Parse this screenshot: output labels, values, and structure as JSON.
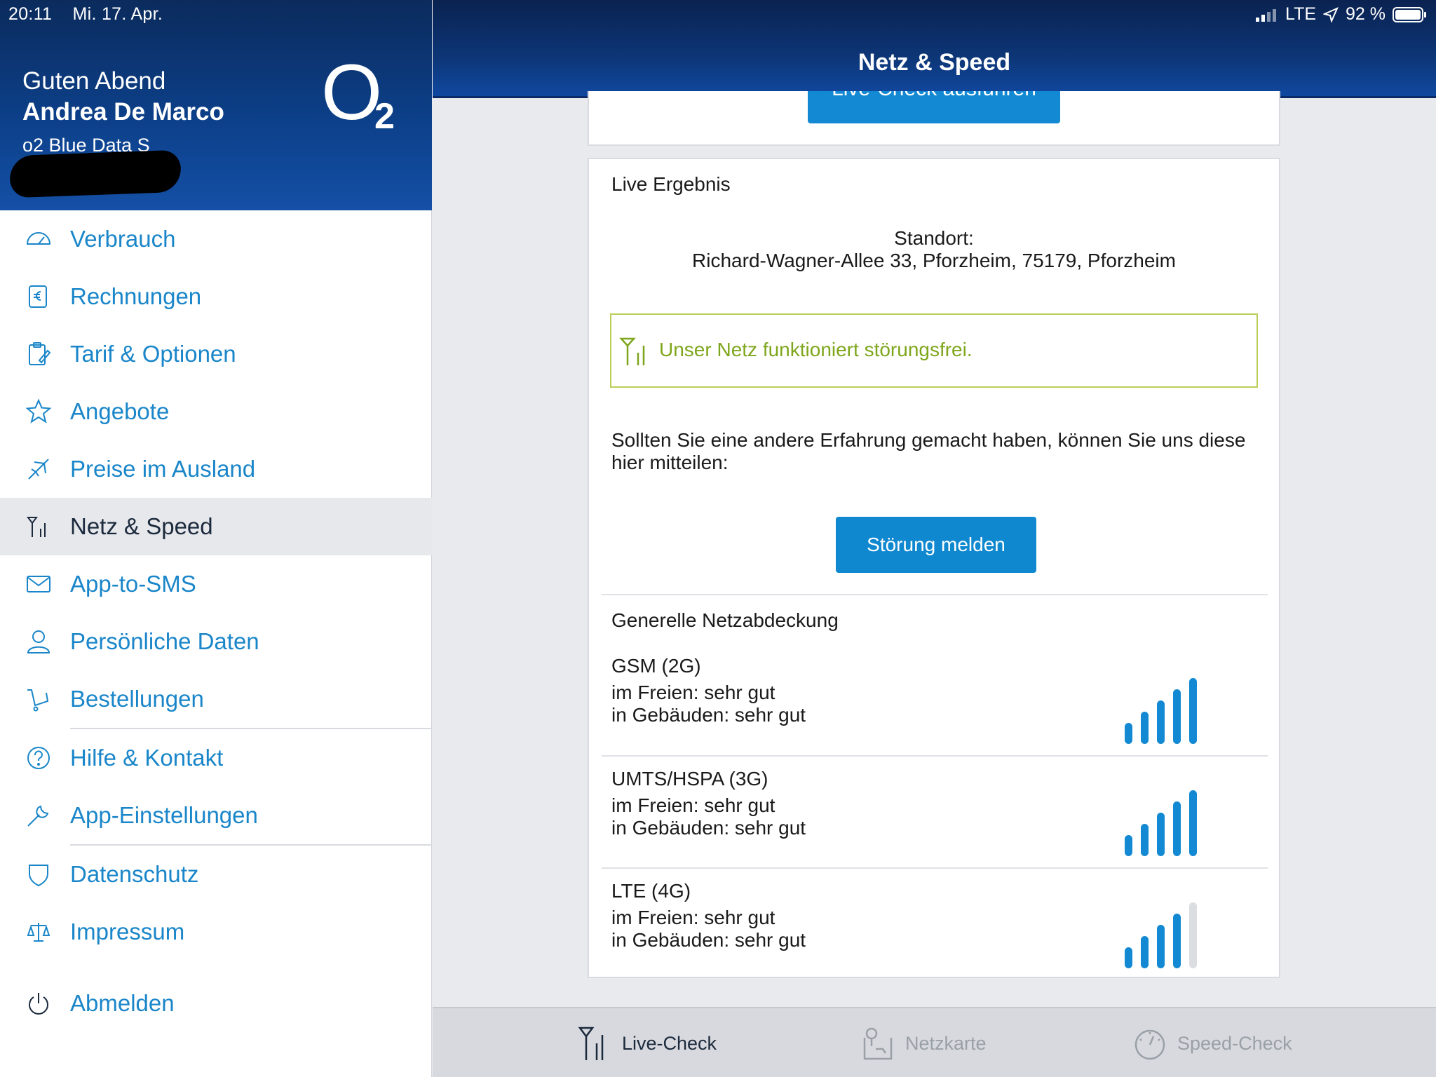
{
  "status": {
    "time": "20:11",
    "date": "Mi. 17. Apr.",
    "network": "LTE",
    "battery": "92 %"
  },
  "profile": {
    "greeting": "Guten Abend",
    "name": "Andrea De Marco",
    "tariff": "o2 Blue Data S",
    "logo_o": "O",
    "logo_2": "2"
  },
  "nav": {
    "items": [
      {
        "label": "Verbrauch",
        "icon": "speedometer-icon"
      },
      {
        "label": "Rechnungen",
        "icon": "invoice-euro-icon"
      },
      {
        "label": "Tarif & Optionen",
        "icon": "clipboard-edit-icon"
      },
      {
        "label": "Angebote",
        "icon": "star-icon"
      },
      {
        "label": "Preise im Ausland",
        "icon": "airplane-icon"
      },
      {
        "label": "Netz & Speed",
        "icon": "antenna-icon",
        "active": true
      },
      {
        "label": "App-to-SMS",
        "icon": "envelope-icon"
      },
      {
        "label": "Persönliche Daten",
        "icon": "person-icon"
      },
      {
        "label": "Bestellungen",
        "icon": "cart-icon"
      },
      {
        "label": "Hilfe & Kontakt",
        "icon": "question-icon"
      },
      {
        "label": "App-Einstellungen",
        "icon": "wrench-icon"
      },
      {
        "label": "Datenschutz",
        "icon": "shield-icon"
      },
      {
        "label": "Impressum",
        "icon": "scales-icon"
      },
      {
        "label": "Abmelden",
        "icon": "power-icon"
      }
    ]
  },
  "header": {
    "title": "Netz & Speed"
  },
  "live_check_button": "Live-Check ausführen",
  "result": {
    "title": "Live Ergebnis",
    "location_label": "Standort:",
    "location": "Richard-Wagner-Allee 33, Pforzheim, 75179, Pforzheim",
    "status_message": "Unser Netz funktioniert störungsfrei.",
    "feedback_text": "Sollten Sie eine andere Erfahrung gemacht haben, können Sie uns diese hier mitteilen:",
    "report_button": "Störung melden"
  },
  "coverage": {
    "title": "Generelle Netzabdeckung",
    "networks": [
      {
        "name": "GSM (2G)",
        "outdoor": "im Freien: sehr gut",
        "indoor": "in Gebäuden: sehr gut",
        "bars_filled": 5,
        "bars_total": 5
      },
      {
        "name": "UMTS/HSPA (3G)",
        "outdoor": "im Freien: sehr gut",
        "indoor": "in Gebäuden: sehr gut",
        "bars_filled": 5,
        "bars_total": 5
      },
      {
        "name": "LTE (4G)",
        "outdoor": "im Freien: sehr gut",
        "indoor": "in Gebäuden: sehr gut",
        "bars_filled": 4,
        "bars_total": 5
      }
    ]
  },
  "tabs": [
    {
      "label": "Live-Check",
      "icon": "antenna-icon",
      "active": true
    },
    {
      "label": "Netzkarte",
      "icon": "map-pin-icon"
    },
    {
      "label": "Speed-Check",
      "icon": "speedometer-icon"
    }
  ],
  "colors": {
    "accent": "#1a86c9",
    "header_dark": "#0b2b5c",
    "ok_green": "#7ea61c",
    "bar_blue": "#1289d2",
    "bar_empty": "#dcdde0"
  }
}
